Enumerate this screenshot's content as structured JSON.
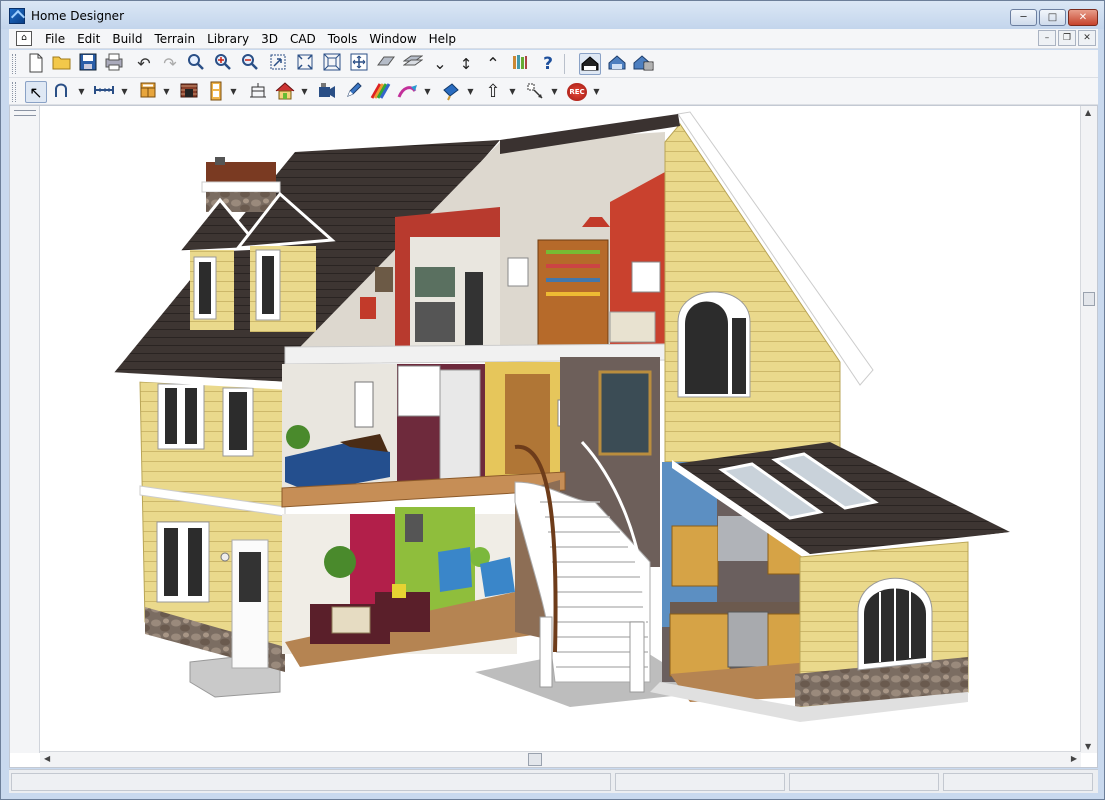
{
  "window": {
    "title": "Home Designer",
    "controls": {
      "minimize": "─",
      "maximize": "□",
      "close": "✕"
    }
  },
  "menubar": {
    "items": [
      "File",
      "Edit",
      "Build",
      "Terrain",
      "Library",
      "3D",
      "CAD",
      "Tools",
      "Window",
      "Help"
    ],
    "mdi_controls": {
      "minimize": "–",
      "restore": "❐",
      "close": "✕"
    }
  },
  "toolbar_top": {
    "icons": [
      "new-document",
      "open-folder",
      "save",
      "print",
      "undo",
      "redo",
      "zoom",
      "zoom-in",
      "zoom-out",
      "zoom-box",
      "fill-window",
      "fill-window-all",
      "pan",
      "swoop",
      "tilt-down",
      "tilt-vertical",
      "tilt-up",
      "library",
      "help",
      "floor-plan",
      "camera-view",
      "overview"
    ]
  },
  "toolbar_bottom": {
    "icons": [
      "select-objects",
      "draw-wall",
      "dimension",
      "cabinet",
      "fireplace",
      "window-door",
      "stairs",
      "roof",
      "camera-tools",
      "paint",
      "material-painter",
      "color",
      "text",
      "arrow",
      "transform",
      "record"
    ],
    "record_label": "REC"
  },
  "colors": {
    "titlebar": "#c3d5ec",
    "siding": "#e9d98a",
    "roof": "#3c3432",
    "trim": "#ffffff",
    "stone": "#6f6259",
    "floor": "#b58452"
  }
}
